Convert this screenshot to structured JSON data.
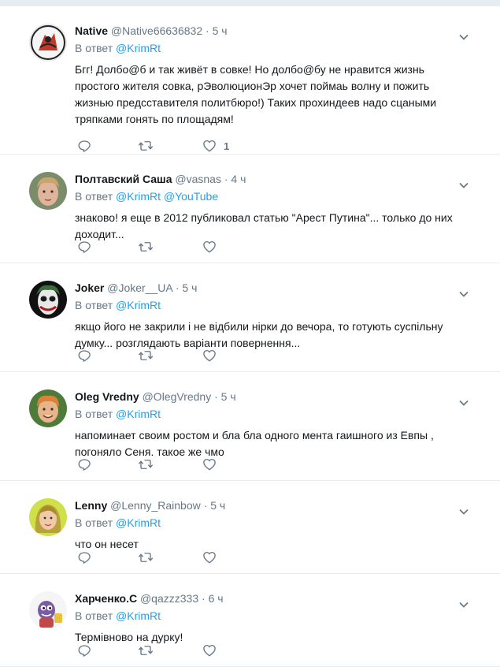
{
  "tweets": [
    {
      "name": "Native",
      "username": "@Native66636832",
      "time": "5 ч",
      "reply_prefix": "В ответ",
      "reply_to": [
        "@KrimRt"
      ],
      "lines": [
        "Бгг! Долбо@б и так живёт в совке! Но долбо@бу не нравится жизнь",
        "простого жителя совка, рЭволюционЭр хочет поймаь волну и пожить",
        "жизнью предсставителя политбюро!) Таких прохиндеев надо сцаными",
        "тряпками гонять по площадям!"
      ],
      "likes": "1",
      "avatar": "native"
    },
    {
      "name": "Полтавский Саша",
      "username": "@vasnas",
      "time": "4 ч",
      "reply_prefix": "В ответ",
      "reply_to": [
        "@KrimRt",
        "@YouTube"
      ],
      "lines": [
        "знаково! я еще в 2012 публиковал статью \"Арест Путина\"... только до них",
        "доходит..."
      ],
      "likes": "",
      "avatar": "man-blond"
    },
    {
      "name": "Joker",
      "username": "@Joker__UA",
      "time": "5 ч",
      "reply_prefix": "В ответ",
      "reply_to": [
        "@KrimRt"
      ],
      "lines": [
        "якщо його не закрили і не відбили нірки до вечора, то готують суспільну",
        "думку... розглядають варіанти повернення..."
      ],
      "likes": "",
      "avatar": "joker"
    },
    {
      "name": "Oleg Vredny",
      "username": "@OlegVredny",
      "time": "5 ч",
      "reply_prefix": "В ответ",
      "reply_to": [
        "@KrimRt"
      ],
      "lines": [
        "напоминает своим ростом и бла бла одного мента гаишного из Евпы ,",
        "погоняло Сеня. такое же чмо"
      ],
      "likes": "",
      "avatar": "oleg"
    },
    {
      "name": "Lenny",
      "username": "@Lenny_Rainbow",
      "time": "5 ч",
      "reply_prefix": "В ответ",
      "reply_to": [
        "@KrimRt"
      ],
      "lines": [
        "что он несет"
      ],
      "likes": "",
      "avatar": "lenny"
    },
    {
      "name": "Харченко.С",
      "username": "@qazzz333",
      "time": "6 ч",
      "reply_prefix": "В ответ",
      "reply_to": [
        "@KrimRt"
      ],
      "lines": [
        "Термівново на дурку!"
      ],
      "likes": "",
      "avatar": "cartoon"
    }
  ],
  "colors": {
    "link": "#1da1f2",
    "muted": "#657786",
    "border": "#e6ecf0",
    "text": "#14171a"
  },
  "icons": [
    "reply-icon",
    "retweet-icon",
    "like-icon",
    "caret-down-icon"
  ]
}
